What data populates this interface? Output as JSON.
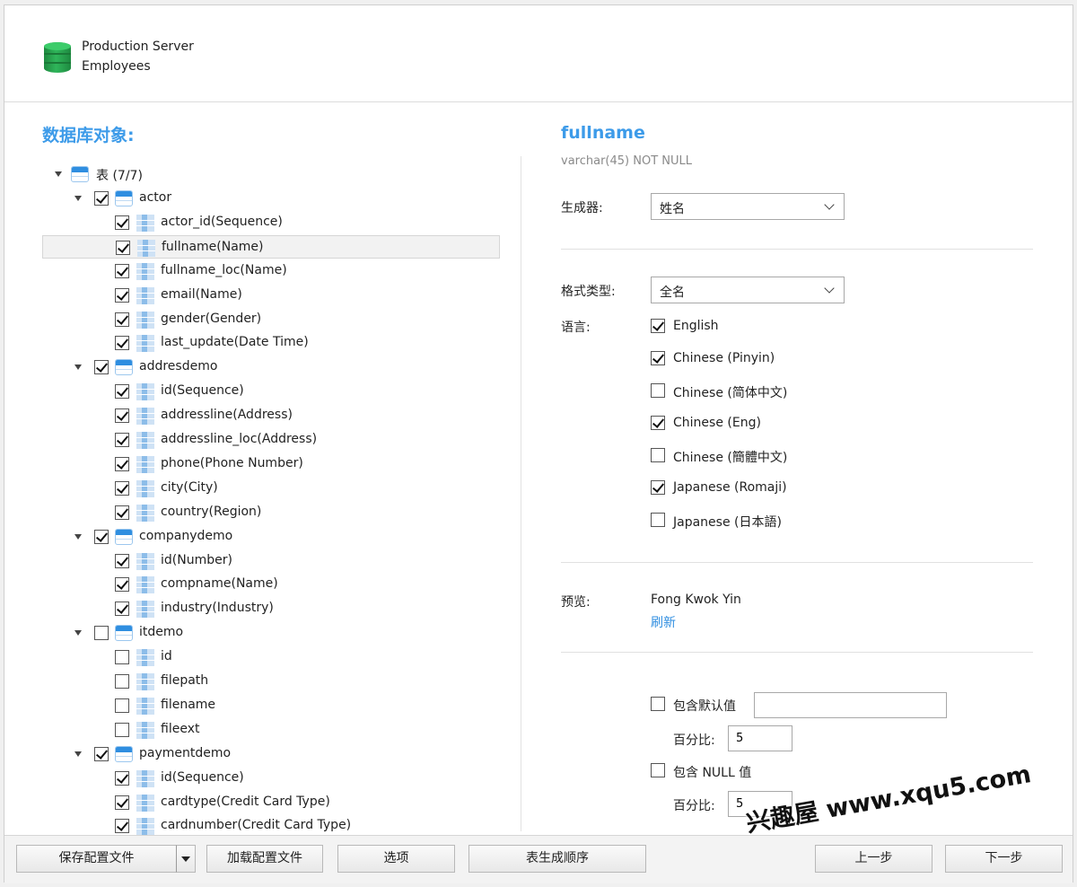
{
  "connection": {
    "server": "Production Server",
    "database": "Employees"
  },
  "left_panel": {
    "title": "数据库对象:",
    "root_label": "表 (7/7)"
  },
  "tree": [
    {
      "kind": "table",
      "label": "actor",
      "checked": true
    },
    {
      "kind": "column",
      "label": "actor_id(Sequence)",
      "checked": true
    },
    {
      "kind": "column",
      "label": "fullname(Name)",
      "checked": true,
      "selected": true
    },
    {
      "kind": "column",
      "label": "fullname_loc(Name)",
      "checked": true
    },
    {
      "kind": "column",
      "label": "email(Name)",
      "checked": true
    },
    {
      "kind": "column",
      "label": "gender(Gender)",
      "checked": true
    },
    {
      "kind": "column",
      "label": "last_update(Date Time)",
      "checked": true
    },
    {
      "kind": "table",
      "label": "addresdemo",
      "checked": true
    },
    {
      "kind": "column",
      "label": "id(Sequence)",
      "checked": true
    },
    {
      "kind": "column",
      "label": "addressline(Address)",
      "checked": true
    },
    {
      "kind": "column",
      "label": "addressline_loc(Address)",
      "checked": true
    },
    {
      "kind": "column",
      "label": "phone(Phone Number)",
      "checked": true
    },
    {
      "kind": "column",
      "label": "city(City)",
      "checked": true
    },
    {
      "kind": "column",
      "label": "country(Region)",
      "checked": true
    },
    {
      "kind": "table",
      "label": "companydemo",
      "checked": true
    },
    {
      "kind": "column",
      "label": "id(Number)",
      "checked": true
    },
    {
      "kind": "column",
      "label": "compname(Name)",
      "checked": true
    },
    {
      "kind": "column",
      "label": "industry(Industry)",
      "checked": true
    },
    {
      "kind": "table",
      "label": "itdemo",
      "checked": false
    },
    {
      "kind": "column",
      "label": "id",
      "checked": false
    },
    {
      "kind": "column",
      "label": "filepath",
      "checked": false
    },
    {
      "kind": "column",
      "label": "filename",
      "checked": false
    },
    {
      "kind": "column",
      "label": "fileext",
      "checked": false
    },
    {
      "kind": "table",
      "label": "paymentdemo",
      "checked": true
    },
    {
      "kind": "column",
      "label": "id(Sequence)",
      "checked": true
    },
    {
      "kind": "column",
      "label": "cardtype(Credit Card Type)",
      "checked": true
    },
    {
      "kind": "column",
      "label": "cardnumber(Credit Card Type)",
      "checked": true
    }
  ],
  "detail": {
    "field_name": "fullname",
    "field_type": "varchar(45) NOT NULL",
    "generator_label": "生成器:",
    "generator_value": "姓名",
    "format_label": "格式类型:",
    "format_value": "全名",
    "language_label": "语言:",
    "languages": [
      {
        "label": "English",
        "checked": true
      },
      {
        "label": "Chinese (Pinyin)",
        "checked": true
      },
      {
        "label": "Chinese (简体中文)",
        "checked": false
      },
      {
        "label": "Chinese (Eng)",
        "checked": true
      },
      {
        "label": "Chinese (簡體中文)",
        "checked": false
      },
      {
        "label": "Japanese (Romaji)",
        "checked": true
      },
      {
        "label": "Japanese (日本語)",
        "checked": false
      }
    ],
    "preview_label": "预览:",
    "preview_value": "Fong Kwok Yin",
    "refresh_label": "刷新",
    "include_default_label": "包含默认值",
    "include_default_checked": false,
    "default_value": "",
    "percent_label": "百分比:",
    "default_percent": "5",
    "include_null_label": "包含 NULL 值",
    "include_null_checked": false,
    "null_percent": "5"
  },
  "buttons": {
    "save_profile": "保存配置文件",
    "load_profile": "加载配置文件",
    "options": "选项",
    "table_order": "表生成顺序",
    "prev": "上一步",
    "next": "下一步"
  },
  "watermark": "兴趣屋 www.xqu5.com"
}
